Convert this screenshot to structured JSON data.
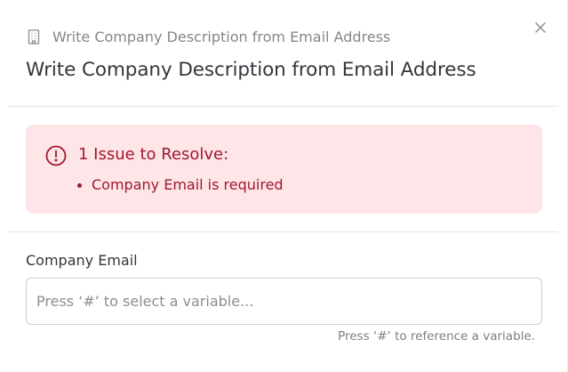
{
  "header": {
    "breadcrumb_icon": "building-icon",
    "breadcrumb_text": "Write Company Description from Email Address",
    "close_icon": "close-icon",
    "title": "Write Company Description from Email Address"
  },
  "alert": {
    "icon": "alert-circle-icon",
    "title": "1 Issue to Resolve:",
    "issues": [
      "Company Email is required"
    ],
    "colors": {
      "background": "#fde5e8",
      "text": "#a0182d"
    }
  },
  "form": {
    "company_email": {
      "label": "Company Email",
      "value": "",
      "placeholder": "Press ‘#’ to select a variable...",
      "hint": "Press ‘#’ to reference a variable."
    }
  }
}
